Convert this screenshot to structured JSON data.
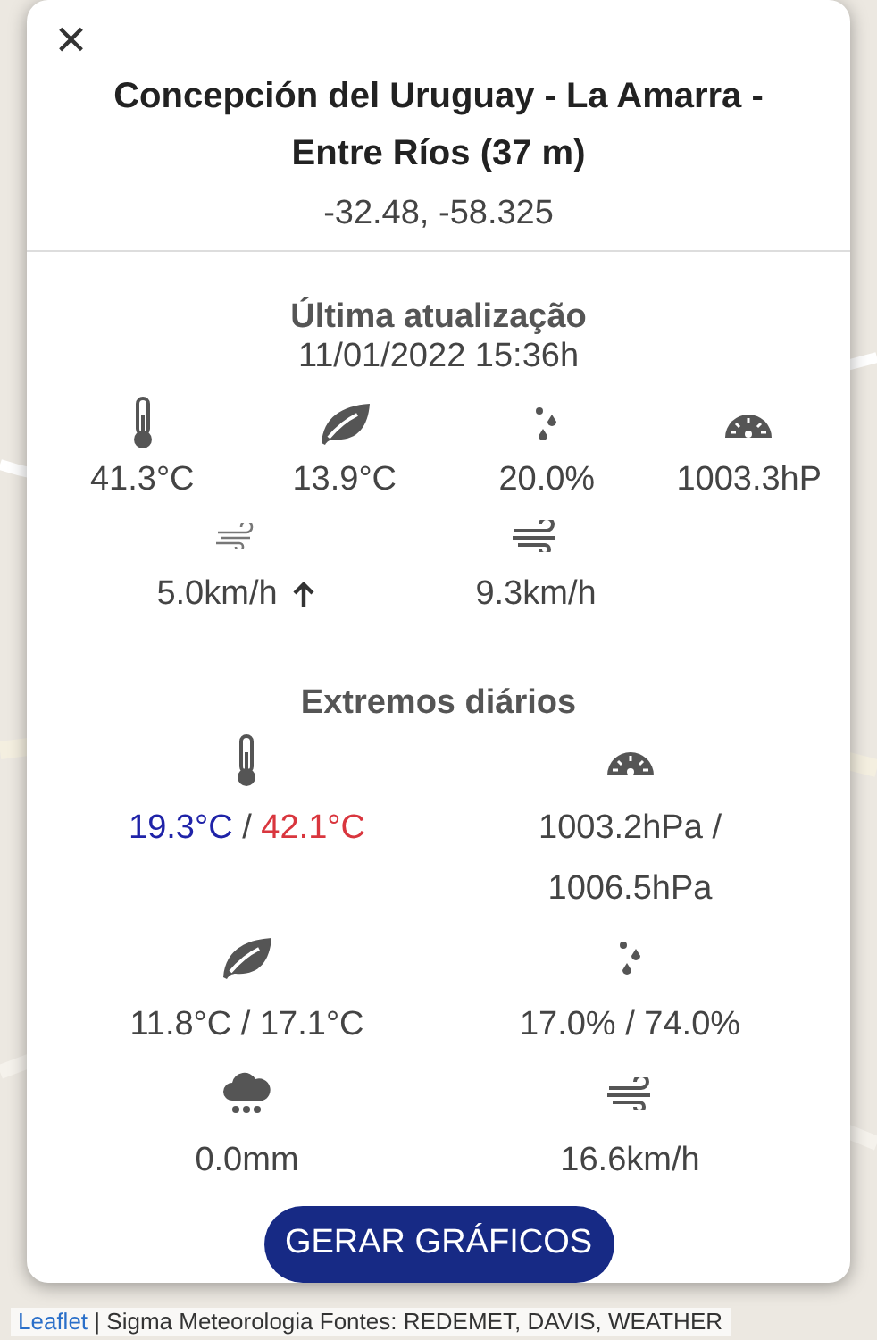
{
  "dialog": {
    "close": "×",
    "title": "Concepción del Uruguay - La Amarra - Entre Ríos (37 m)",
    "coordinates": "-32.48, -58.325",
    "latest": {
      "heading": "Última atualização",
      "timestamp": "11/01/2022 15:36h",
      "readings": [
        {
          "kind": "thermometer",
          "value": "41.3°C"
        },
        {
          "kind": "leaf",
          "value": "13.9°C"
        },
        {
          "kind": "drops",
          "value": "20.0%"
        },
        {
          "kind": "gauge",
          "value": "1003.3hP"
        }
      ],
      "wind": [
        {
          "kind": "breeze",
          "value": "5.0km/h",
          "direction_arrow": true
        },
        {
          "kind": "wind",
          "value": "9.3km/h",
          "direction_arrow": false
        }
      ]
    },
    "extremes": {
      "heading": "Extremos diários",
      "items": [
        {
          "kind": "thermometer",
          "parts": [
            {
              "text": "19.3°C",
              "color": "#1f23a8"
            },
            {
              "text": " / "
            },
            {
              "text": "42.1°C",
              "color": "#d9363e"
            }
          ]
        },
        {
          "kind": "gauge",
          "parts": [
            {
              "text": "1003.2hPa / 1006.5hPa"
            }
          ]
        },
        {
          "kind": "leaf",
          "parts": [
            {
              "text": "11.8°C / 17.1°C"
            }
          ]
        },
        {
          "kind": "drops",
          "parts": [
            {
              "text": "17.0% / 74.0%"
            }
          ]
        },
        {
          "kind": "rain",
          "parts": [
            {
              "text": "0.0mm"
            }
          ]
        },
        {
          "kind": "wind",
          "parts": [
            {
              "text": "16.6km/h"
            }
          ]
        }
      ]
    },
    "button": "GERAR GRÁFICOS"
  },
  "attribution": {
    "leaflet": "Leaflet",
    "rest": "| Sigma Meteorologia Fontes: REDEMET, DAVIS, WEATHER"
  }
}
